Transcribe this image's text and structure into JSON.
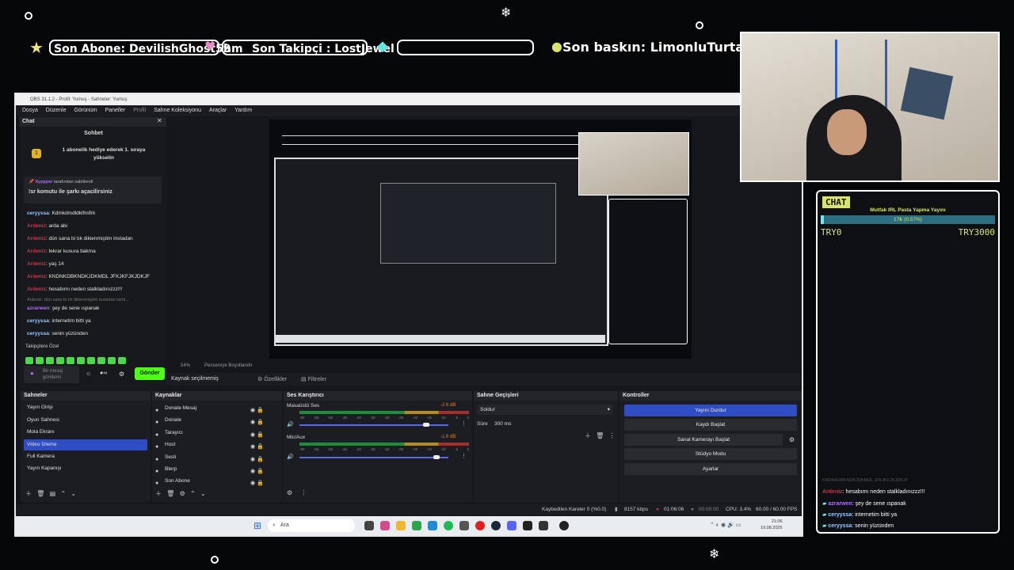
{
  "stream_bar": {
    "last_sub": "Son Abone: DevilishGhost59",
    "hm": "hm",
    "last_follower": "Son Takipçi : LostJewel",
    "last_raid": "Son baskın: LimonluTurta"
  },
  "obs": {
    "window_title": "OBS 31.1.2 - Profil: Yumuş - Sahneler: Yumuş",
    "menu": [
      "Dosya",
      "Düzenle",
      "Görünüm",
      "Paneller",
      "Profil",
      "Sahne Koleksiyonu",
      "Araçlar",
      "Yardım"
    ],
    "chat_panel_title": "Chat",
    "chat_header": "Sohbet",
    "gift_banner": "1 abonelik hediye ederek 1. sıraya yükselin",
    "pinned_by": "tarafından sabitlendi",
    "pinned_user": "Xyppper",
    "pinned_text": "!sr komutu ile şarkı açacilirsiniz",
    "chat_messages": [
      {
        "user": "ceryyssa",
        "text": ": Kdmkdmdldklfmflrk",
        "color": "blue"
      },
      {
        "user": "Ardeniz",
        "text": ": arda abi",
        "color": "red"
      },
      {
        "user": "Ardeniz",
        "text": ": dün sana bi tık dikienmiştim instadan",
        "color": "red"
      },
      {
        "user": "Ardeniz",
        "text": ": tekrar kusura bakma",
        "color": "red"
      },
      {
        "user": "Ardeniz",
        "text": ": yaş 14",
        "color": "red"
      },
      {
        "user": "Ardeniz",
        "text": ": KNDNKDBKNDKJDKMDL JFKJKFJKJDKJF",
        "color": "red"
      },
      {
        "user": "Ardeniz",
        "text": ": hesabımı neden stalkladınızzz!!!",
        "color": "red"
      },
      {
        "user": "Ardeniz",
        "text": ": dün sana bi tık dikienmiştim instadan isimi...",
        "color": "gray"
      },
      {
        "user": "azrarwen",
        "text": ": şey de sene ıspanak",
        "color": "purple"
      },
      {
        "user": "ceryyssa",
        "text": ": internetim bitti ya",
        "color": "blue"
      },
      {
        "user": "ceryyssa",
        "text": ": senin yüzünden",
        "color": "blue"
      }
    ],
    "follower_special": "Takipçilere Özel",
    "message_placeholder": "Bir mesaj gönderin",
    "send_label": "Gönder",
    "zoom_label": "54%",
    "fit_label": "Pencereye Boyutlandır",
    "no_source": "Kaynak seçilmemiş",
    "properties": "Özellikler",
    "filters": "Filtreler",
    "scenes_title": "Sahneler",
    "scenes": [
      "Yayın Girişi",
      "Oyun Sahnesi",
      "Mola Ekranı",
      "Video İzleme",
      "Full Kamera",
      "Yayın Kapanışı"
    ],
    "selected_scene_index": 3,
    "sources_title": "Kaynaklar",
    "sources": [
      "Donate Mesaj",
      "Donate",
      "Tarayıcı",
      "Host",
      "Sesli",
      "Blerp",
      "Son Abone"
    ],
    "mixer_title": "Ses Karıştırıcı",
    "mixer": [
      {
        "name": "Masaüstü Ses",
        "db": "-2.6 dB",
        "level": 0.85
      },
      {
        "name": "Mic/Aux",
        "db": "-1.6 dB",
        "level": 0.92
      }
    ],
    "mixer_ticks": [
      "-60",
      "-55",
      "-50",
      "-45",
      "-40",
      "-35",
      "-30",
      "-25",
      "-20",
      "-15",
      "-10",
      "-5",
      "0"
    ],
    "transitions_title": "Sahne Geçişleri",
    "transition": "Soldur",
    "duration_label": "Süre",
    "duration_value": "300 ms",
    "controls_title": "Kontroller",
    "controls": [
      "Yayını Durdur",
      "Kaydı Başlat",
      "Sanal Kamerayı Başlat",
      "Stüdyo Modu",
      "Ayarlar"
    ],
    "status": {
      "dropped": "Kaybedilen Kareler 0 (%0.0)",
      "bitrate": "8157 kbps",
      "stream_time": "01:06:06",
      "rec_time": "00:00:00",
      "cpu": "CPU: 3.4%",
      "fps": "60.00 / 60.00 FPS"
    },
    "taskbar": {
      "search": "Ara",
      "time": "21:06",
      "date": "19.08.2025"
    }
  },
  "overlay_chat": {
    "badge": "CHAT",
    "goal_title": "Mutfak IRL Pasta Yapma Yayını",
    "goal_progress": "17₺ (0.57%)",
    "goal_fraction": 0.0057,
    "goal_min": "TRY0",
    "goal_max": "TRY3000",
    "messages": [
      {
        "user": "KNDNKDBKNDKJDKMDL JFKJKFJKJDKJF",
        "text": "",
        "color": "gray"
      },
      {
        "user": "Ardeniz",
        "text": ": hesabımı neden stalkladınızzz!!!",
        "color": "red"
      },
      {
        "user": "azrarwen",
        "text": ": şey de sene ıspanak",
        "color": "purple"
      },
      {
        "user": "ceryyssa",
        "text": ": internetim bitti ya",
        "color": "blue"
      },
      {
        "user": "ceryyssa",
        "text": ": senin yüzünden",
        "color": "blue"
      }
    ]
  }
}
